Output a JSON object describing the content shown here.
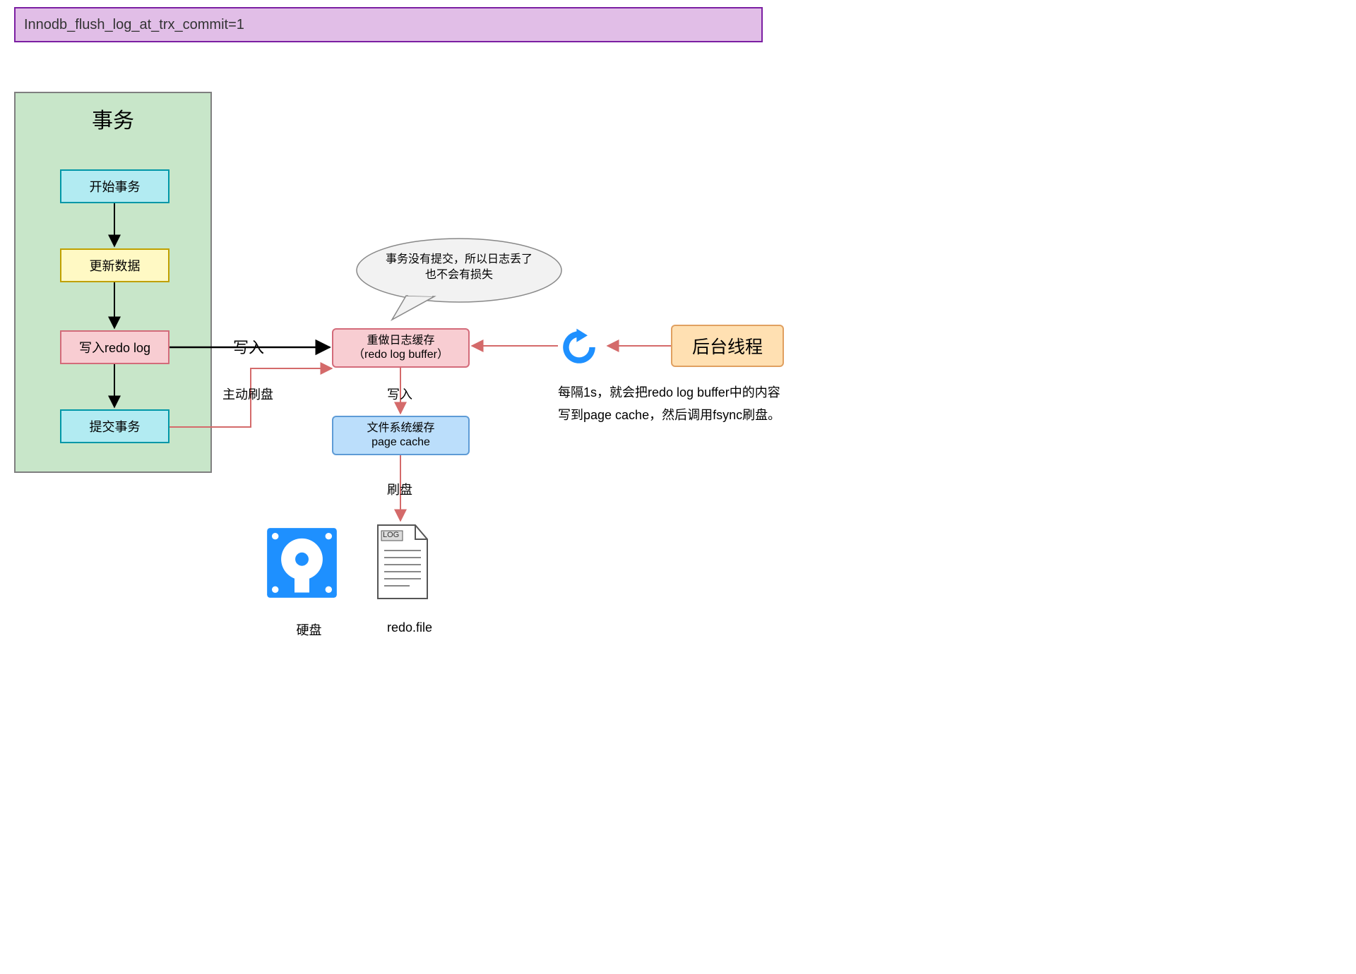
{
  "header": {
    "text": "Innodb_flush_log_at_trx_commit=1"
  },
  "tx_container": {
    "title": "事务"
  },
  "nodes": {
    "start_tx": "开始事务",
    "update": "更新数据",
    "write_redo": "写入redo log",
    "commit": "提交事务",
    "buffer_l1": "重做日志缓存",
    "buffer_l2": "（redo log buffer）",
    "page_l1": "文件系统缓存",
    "page_l2": "page cache",
    "bg_thread": "后台线程"
  },
  "edge_labels": {
    "write": "写入",
    "active_flush": "主动刷盘",
    "write2": "写入",
    "flush_disk": "刷盘"
  },
  "bubble": {
    "l1": "事务没有提交，所以日志丢了",
    "l2": "也不会有损失"
  },
  "bg_note": {
    "l1": "每隔1s，就会把redo log buffer中的内容",
    "l2": "写到page cache，然后调用fsync刷盘。"
  },
  "disk": {
    "label": "硬盘"
  },
  "file": {
    "tag": "LOG",
    "label": "redo.file"
  },
  "colors": {
    "header_fill": "#e1bee7",
    "header_stroke": "#7b1fa2",
    "container_fill": "#c8e6c9",
    "container_stroke": "#7f7f7f",
    "cyan_fill": "#b2ebf2",
    "cyan_stroke": "#0097a7",
    "yellow_fill": "#fff9c4",
    "yellow_stroke": "#c0a000",
    "pink_fill": "#f8cdd2",
    "pink_stroke": "#d36b7a",
    "blue_fill": "#bbdefb",
    "blue_stroke": "#5e9bd6",
    "orange_fill": "#ffe0b2",
    "orange_stroke": "#e0a060",
    "red_arrow": "#d46a6a",
    "black": "#000000",
    "blue_icon": "#1e90ff"
  }
}
